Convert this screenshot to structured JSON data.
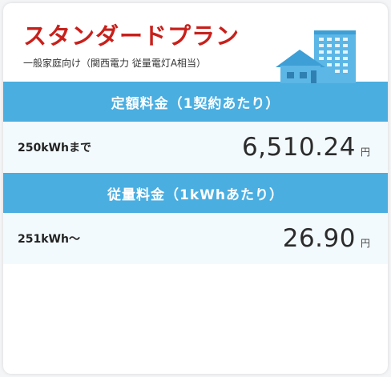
{
  "plan": {
    "title": "スタンダードプラン",
    "subtitle": "一般家庭向け（関西電力 従量電灯A相当）",
    "illustration": "house-and-building-icon",
    "accent_color": "#c8201b",
    "section_color": "#4aaee1"
  },
  "basic_fee": {
    "header": "定額料金（1契約あたり）",
    "label": "250kWhまで",
    "amount": "6,510.24",
    "unit": "円"
  },
  "usage_fee": {
    "header": "従量料金（1kWhあたり）",
    "label": "251kWh～",
    "amount": "26.90",
    "unit": "円"
  }
}
